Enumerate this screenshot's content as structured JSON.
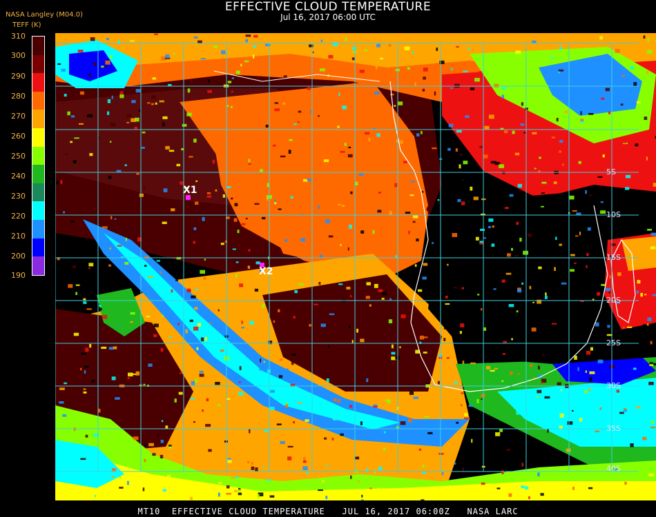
{
  "header": {
    "title": "EFFECTIVE CLOUD TEMPERATURE",
    "datetime": "Jul 16, 2017 06:00 UTC",
    "organization": "NASA Langley (M04.0)",
    "unit": "TEFF (K)"
  },
  "legend": {
    "ticks": [
      "310",
      "300",
      "290",
      "280",
      "270",
      "260",
      "250",
      "240",
      "230",
      "220",
      "210",
      "200",
      "190"
    ],
    "colors": [
      "#4a0000",
      "#7a0000",
      "#ee1111",
      "#ff6a00",
      "#ffa500",
      "#ffff00",
      "#88ff00",
      "#1fb81f",
      "#1a8a5a",
      "#00ffff",
      "#1e90ff",
      "#0000ff",
      "#8a2be2"
    ]
  },
  "markers": [
    {
      "label": "X1"
    },
    {
      "label": "X2"
    }
  ],
  "latitudes": [
    "5S",
    "10S",
    "15S",
    "20S",
    "25S",
    "30S",
    "35S",
    "40S"
  ],
  "footer": "MT10  EFFECTIVE CLOUD TEMPERATURE   JUL 16, 2017 06:00Z   NASA LARC",
  "style": {
    "grid_color": "#3fd0e0",
    "coast_color": "#ffffff",
    "marker_color": "#ff22ff"
  }
}
